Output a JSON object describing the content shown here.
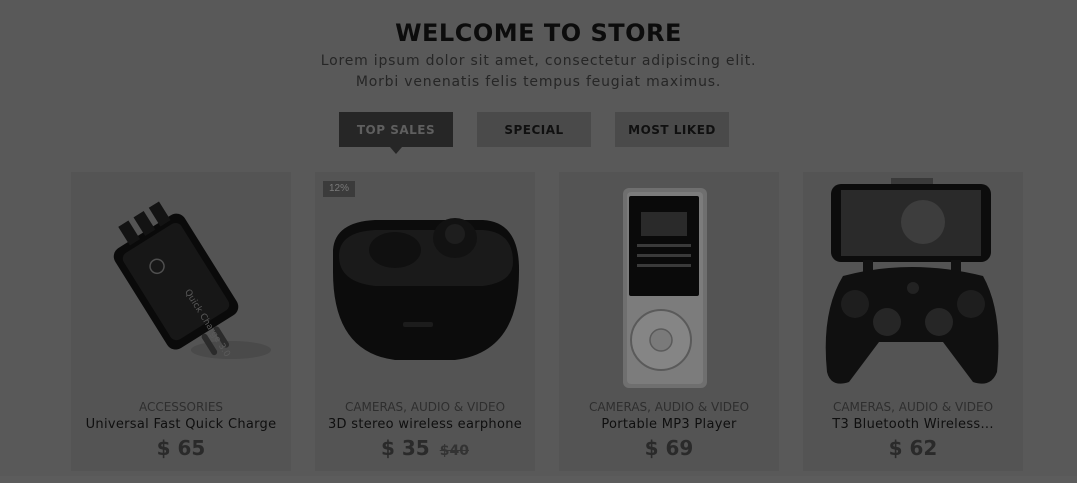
{
  "header": {
    "title": "WELCOME TO STORE",
    "subtitle_line1": "Lorem ipsum dolor sit amet, consectetur adipiscing elit.",
    "subtitle_line2": "Morbi venenatis felis tempus feugiat maximus."
  },
  "tabs": [
    {
      "label": "TOP SALES",
      "active": true
    },
    {
      "label": "SPECIAL",
      "active": false
    },
    {
      "label": "MOST LIKED",
      "active": false
    }
  ],
  "products": [
    {
      "category": "ACCESSORIES",
      "name": "Universal Fast Quick Charge",
      "price": "$ 65",
      "image": "wall-charger-icon"
    },
    {
      "category": "CAMERAS, AUDIO & VIDEO",
      "name": "3D stereo wireless earphone",
      "price": "$ 35",
      "old_price": "$40",
      "badge": "12%",
      "image": "earbuds-case-icon"
    },
    {
      "category": "CAMERAS, AUDIO & VIDEO",
      "name": "Portable MP3 Player",
      "price": "$ 69",
      "image": "mp3-player-icon"
    },
    {
      "category": "CAMERAS, AUDIO & VIDEO",
      "name": "T3 Bluetooth Wireless...",
      "price": "$ 62",
      "image": "gamepad-phone-icon"
    }
  ]
}
